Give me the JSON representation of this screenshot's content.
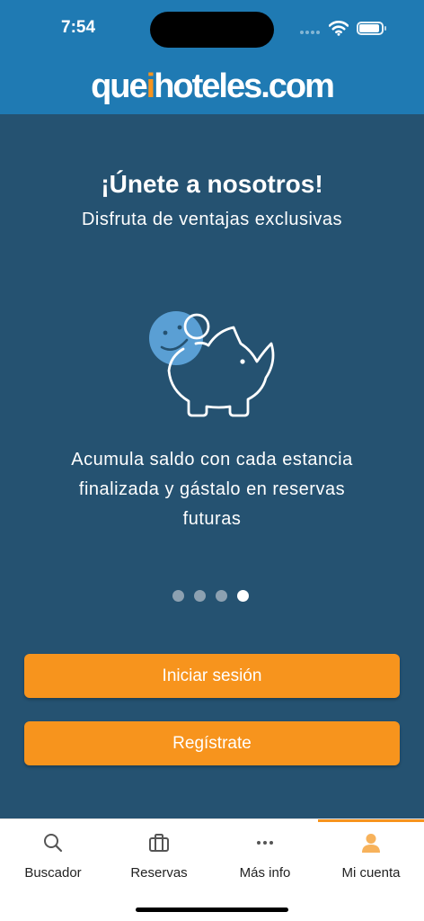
{
  "status": {
    "time": "7:54"
  },
  "header": {
    "logo_prefix": "que",
    "logo_accent": "i",
    "logo_suffix": "hoteles.com"
  },
  "onboarding": {
    "title": "¡Únete a nosotros!",
    "subtitle": "Disfruta de ventajas exclusivas",
    "illustration_icon": "piggy-bank-coin-icon",
    "description": "Acumula saldo con cada estancia finalizada y gástalo en reservas futuras",
    "page_count": 4,
    "active_page": 4
  },
  "buttons": {
    "login": "Iniciar sesión",
    "register": "Regístrate"
  },
  "tabs": [
    {
      "label": "Buscador",
      "icon": "search-icon",
      "active": false
    },
    {
      "label": "Reservas",
      "icon": "briefcase-icon",
      "active": false
    },
    {
      "label": "Más info",
      "icon": "more-dots-icon",
      "active": false
    },
    {
      "label": "Mi cuenta",
      "icon": "user-icon",
      "active": true
    }
  ],
  "colors": {
    "header": "#1f7ab3",
    "background": "#255271",
    "accent": "#f7941d",
    "tab_active": "#f7b25b",
    "tab_icon": "#555555"
  }
}
